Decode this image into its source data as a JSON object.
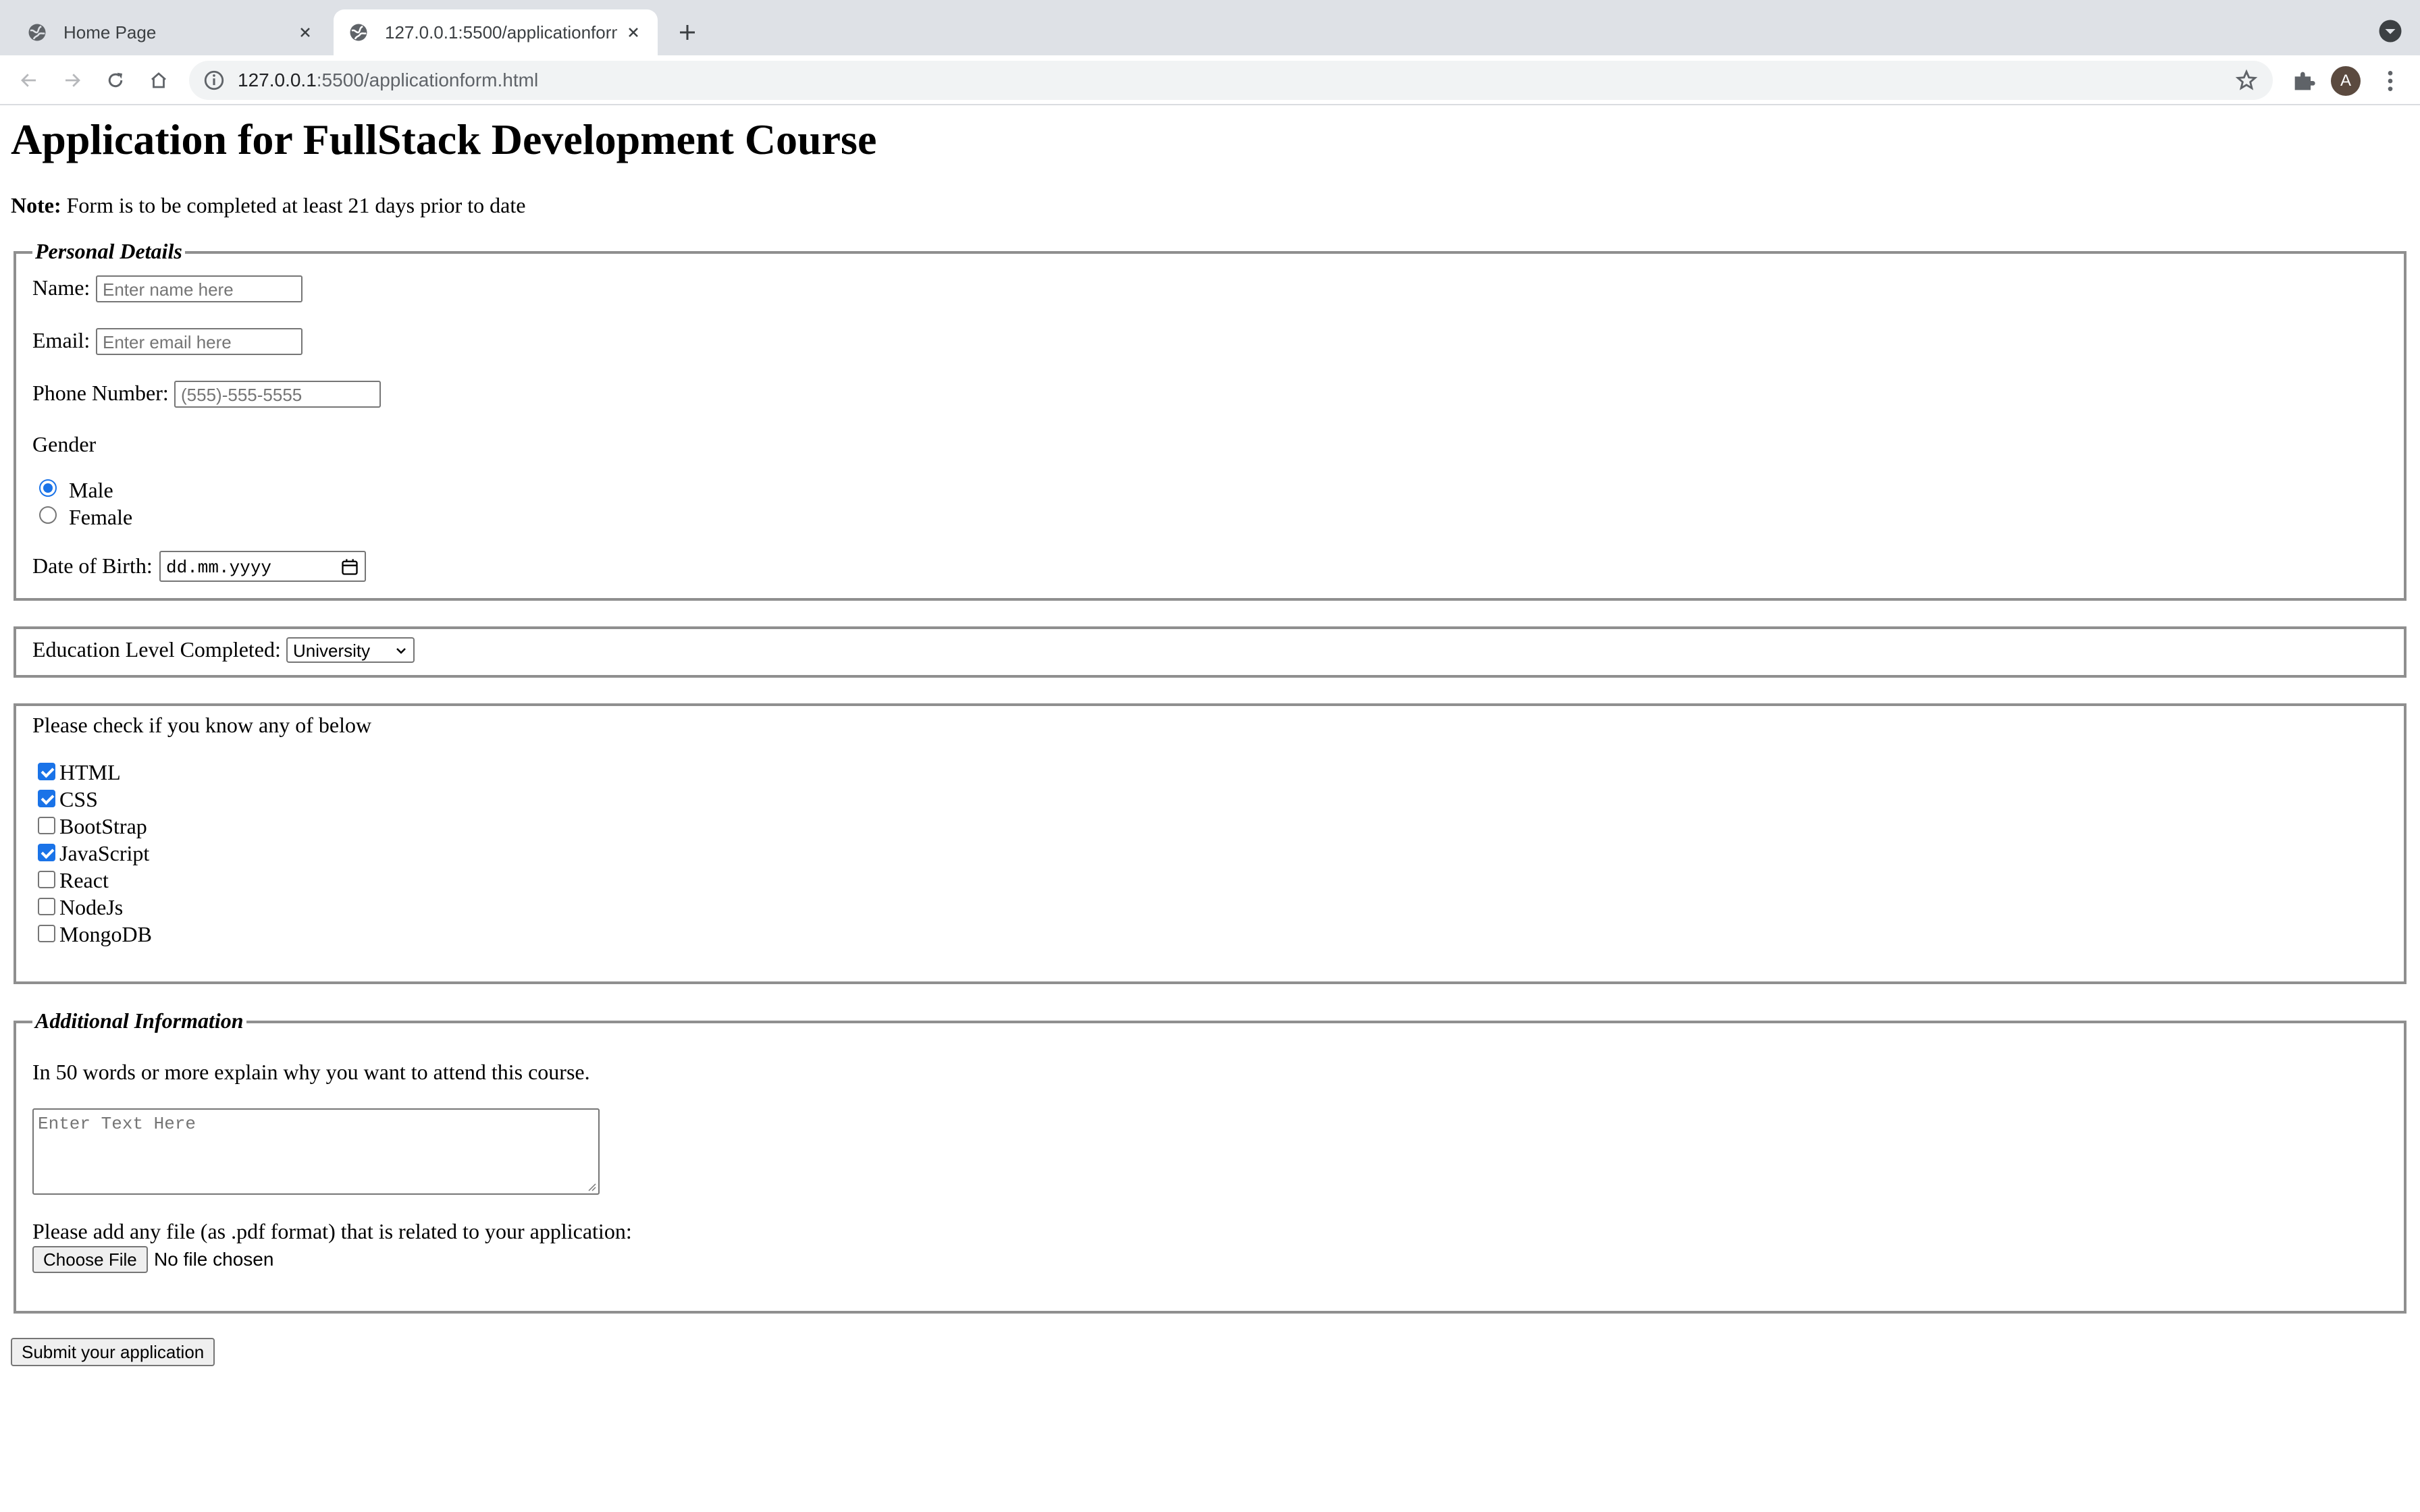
{
  "browser": {
    "tabs": [
      {
        "title": "Home Page",
        "active": false
      },
      {
        "title": "127.0.0.1:5500/applicationform.html",
        "active": true
      }
    ],
    "address": {
      "host": "127.0.0.1",
      "path": ":5500/applicationform.html"
    },
    "profile_initial": "A"
  },
  "page": {
    "heading": "Application for FullStack Development Course",
    "note_label": "Note:",
    "note_text": " Form is to be completed at least 21 days prior to date"
  },
  "personal": {
    "legend": "Personal Details",
    "name_label": "Name:",
    "name_placeholder": "Enter name here",
    "email_label": "Email:",
    "email_placeholder": "Enter email here",
    "phone_label": "Phone Number:",
    "phone_placeholder": "(555)-555-5555",
    "gender_label": "Gender",
    "gender_options": [
      {
        "label": "Male",
        "checked": true
      },
      {
        "label": "Female",
        "checked": false
      }
    ],
    "dob_label": "Date of Birth:",
    "dob_value": "dd.mm.yyyy"
  },
  "education": {
    "label": "Education Level Completed:",
    "selected": "University"
  },
  "skills": {
    "prompt": "Please check if you know any of below",
    "items": [
      {
        "label": "HTML",
        "checked": true
      },
      {
        "label": "CSS",
        "checked": true
      },
      {
        "label": "BootStrap",
        "checked": false
      },
      {
        "label": "JavaScript",
        "checked": true
      },
      {
        "label": "React",
        "checked": false
      },
      {
        "label": "NodeJs",
        "checked": false
      },
      {
        "label": "MongoDB",
        "checked": false
      }
    ]
  },
  "additional": {
    "legend": "Additional Information",
    "question": "In 50 words or more explain why you want to attend this course.",
    "textarea_placeholder": "Enter Text Here",
    "file_label": "Please add any file (as .pdf format) that is related to your application:",
    "file_button": "Choose File",
    "file_status": "No file chosen"
  },
  "submit_label": "Submit your application"
}
